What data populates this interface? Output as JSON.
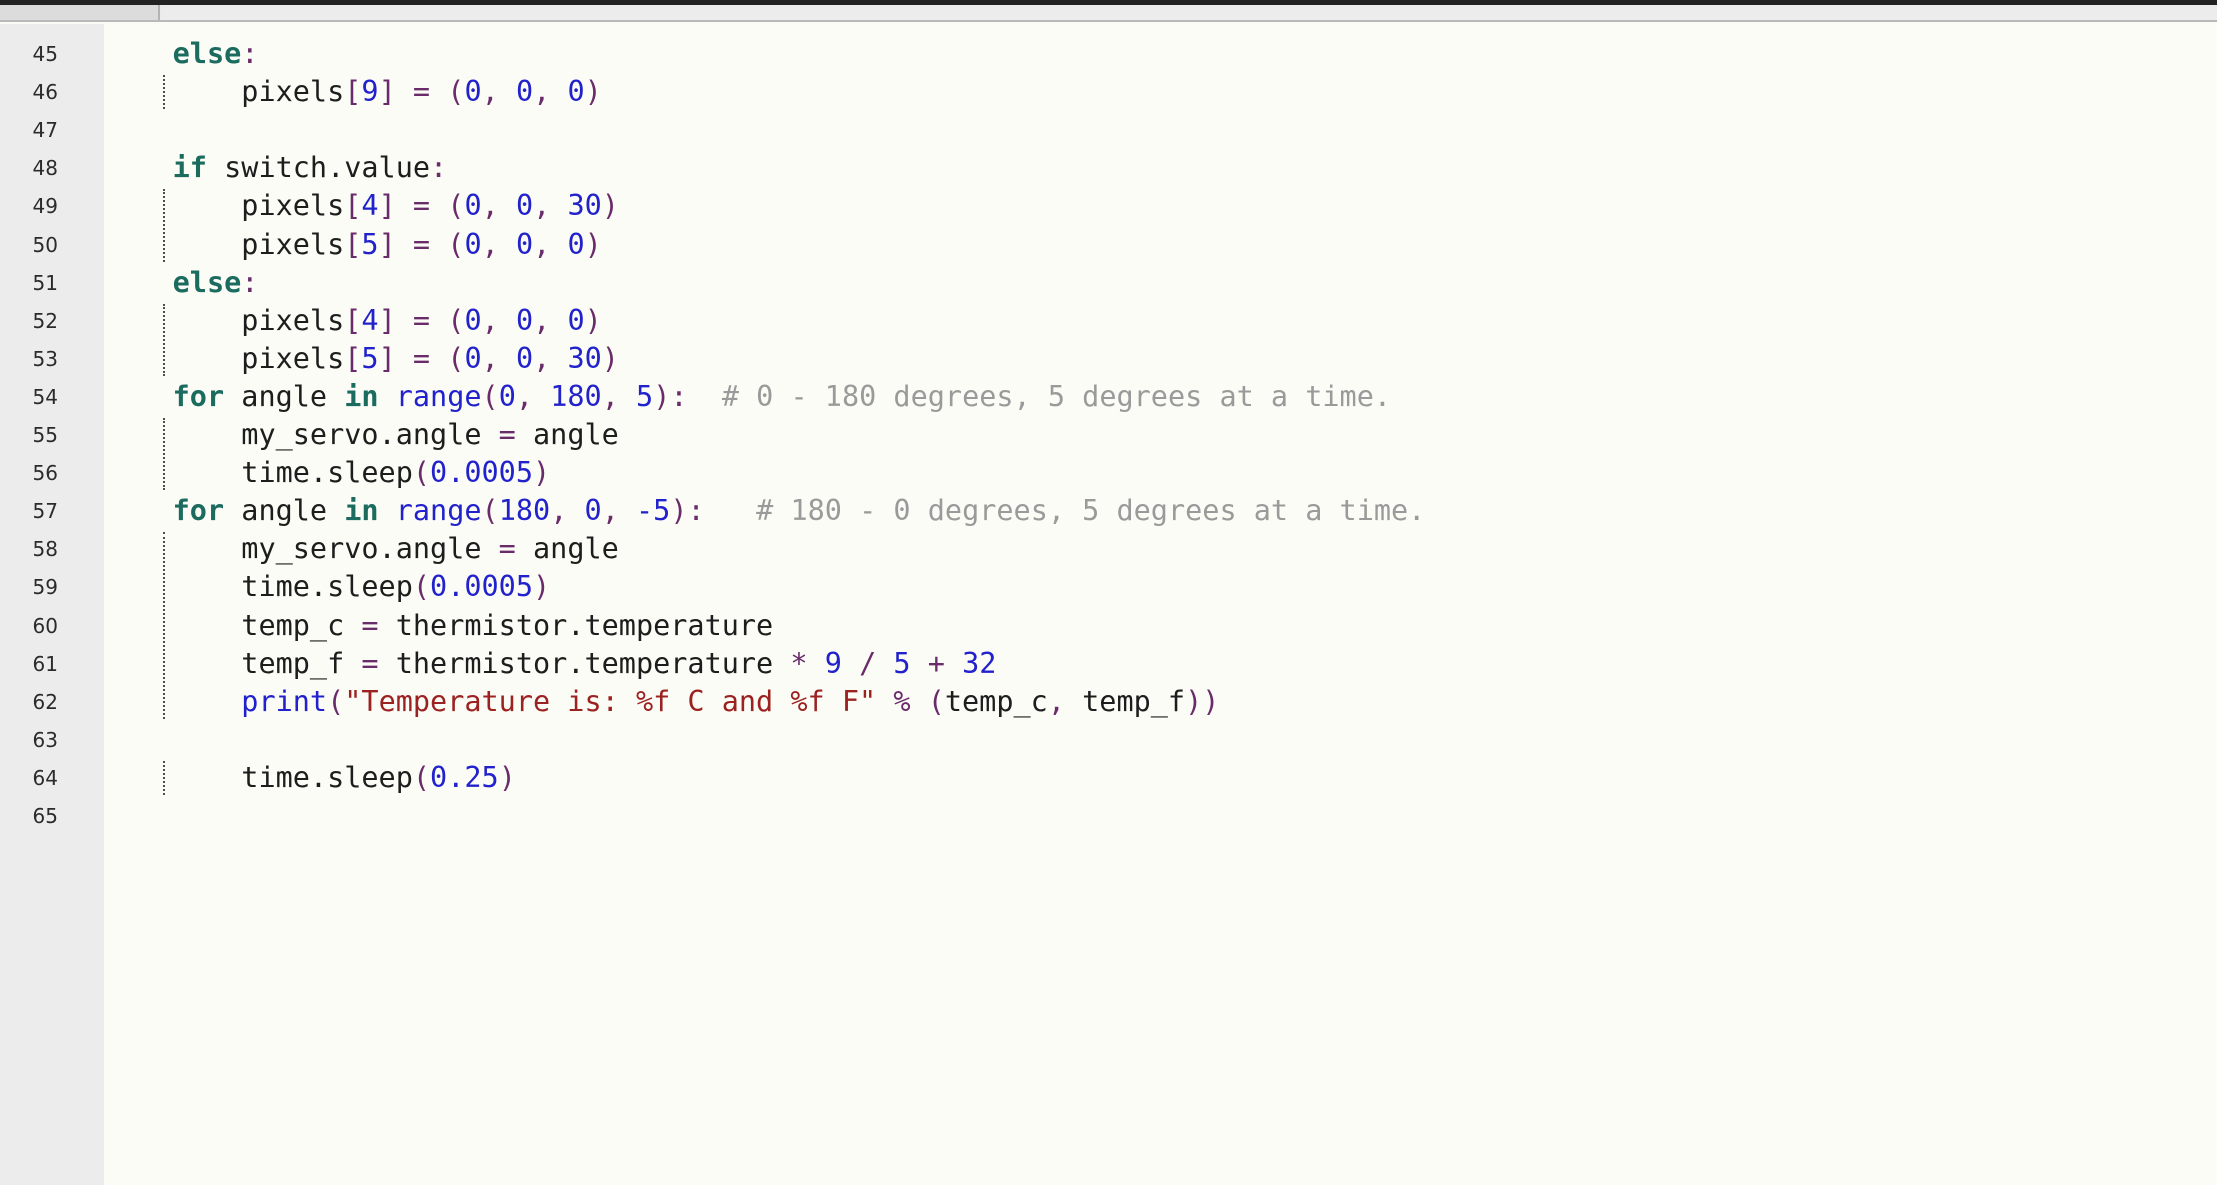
{
  "window": {
    "kind": "code-editor",
    "title_strip_color": "#232323",
    "toolbar_color": "#ebebeb",
    "tab_color": "#dcdcdc"
  },
  "editor": {
    "gutter_color": "#ececec",
    "background_color": "#fcfcf6",
    "language": "python",
    "first_visible_line": 45,
    "last_visible_line": 65,
    "indent_guide_color": "#2f2f2f",
    "theme_colors": {
      "keyword": "#1b6b5e",
      "function": "#2222cc",
      "number": "#2222cc",
      "operator": "#6a2b6a",
      "string": "#9c2222",
      "comment": "#9a9a9a",
      "identifier": "#1d1d1d"
    },
    "line_numbers": [
      "45",
      "46",
      "47",
      "48",
      "49",
      "50",
      "51",
      "52",
      "53",
      "54",
      "55",
      "56",
      "57",
      "58",
      "59",
      "60",
      "61",
      "62",
      "63",
      "64",
      "65"
    ],
    "lines": [
      {
        "number": "45",
        "text": "    else:"
      },
      {
        "number": "46",
        "text": "        pixels[9] = (0, 0, 0)"
      },
      {
        "number": "47",
        "text": ""
      },
      {
        "number": "48",
        "text": "    if switch.value:"
      },
      {
        "number": "49",
        "text": "        pixels[4] = (0, 0, 30)"
      },
      {
        "number": "50",
        "text": "        pixels[5] = (0, 0, 0)"
      },
      {
        "number": "51",
        "text": "    else:"
      },
      {
        "number": "52",
        "text": "        pixels[4] = (0, 0, 0)"
      },
      {
        "number": "53",
        "text": "        pixels[5] = (0, 0, 30)"
      },
      {
        "number": "54",
        "text": "    for angle in range(0, 180, 5):  # 0 - 180 degrees, 5 degrees at a time."
      },
      {
        "number": "55",
        "text": "        my_servo.angle = angle"
      },
      {
        "number": "56",
        "text": "        time.sleep(0.0005)"
      },
      {
        "number": "57",
        "text": "    for angle in range(180, 0, -5):   # 180 - 0 degrees, 5 degrees at a time."
      },
      {
        "number": "58",
        "text": "        my_servo.angle = angle"
      },
      {
        "number": "59",
        "text": "        time.sleep(0.0005)"
      },
      {
        "number": "60",
        "text": "        temp_c = thermistor.temperature"
      },
      {
        "number": "61",
        "text": "        temp_f = thermistor.temperature * 9 / 5 + 32"
      },
      {
        "number": "62",
        "text": "        print(\"Temperature is: %f C and %f F\" % (temp_c, temp_f))"
      },
      {
        "number": "63",
        "text": ""
      },
      {
        "number": "64",
        "text": "        time.sleep(0.25)"
      },
      {
        "number": "65",
        "text": ""
      }
    ],
    "tokens": {
      "l45": [
        {
          "t": "else",
          "c": "kw"
        },
        {
          "t": ":",
          "c": "op"
        }
      ],
      "l46": [
        {
          "t": "pixels",
          "c": "id"
        },
        {
          "t": "[",
          "c": "op"
        },
        {
          "t": "9",
          "c": "num"
        },
        {
          "t": "]",
          "c": "op"
        },
        {
          "t": " ",
          "c": "id"
        },
        {
          "t": "=",
          "c": "op"
        },
        {
          "t": " ",
          "c": "id"
        },
        {
          "t": "(",
          "c": "op"
        },
        {
          "t": "0",
          "c": "num"
        },
        {
          "t": ", ",
          "c": "op"
        },
        {
          "t": "0",
          "c": "num"
        },
        {
          "t": ", ",
          "c": "op"
        },
        {
          "t": "0",
          "c": "num"
        },
        {
          "t": ")",
          "c": "op"
        }
      ],
      "l48": [
        {
          "t": "if",
          "c": "kw"
        },
        {
          "t": " switch.value",
          "c": "id"
        },
        {
          "t": ":",
          "c": "op"
        }
      ],
      "l49": [
        {
          "t": "pixels",
          "c": "id"
        },
        {
          "t": "[",
          "c": "op"
        },
        {
          "t": "4",
          "c": "num"
        },
        {
          "t": "]",
          "c": "op"
        },
        {
          "t": " ",
          "c": "id"
        },
        {
          "t": "=",
          "c": "op"
        },
        {
          "t": " ",
          "c": "id"
        },
        {
          "t": "(",
          "c": "op"
        },
        {
          "t": "0",
          "c": "num"
        },
        {
          "t": ", ",
          "c": "op"
        },
        {
          "t": "0",
          "c": "num"
        },
        {
          "t": ", ",
          "c": "op"
        },
        {
          "t": "30",
          "c": "num"
        },
        {
          "t": ")",
          "c": "op"
        }
      ],
      "l50": [
        {
          "t": "pixels",
          "c": "id"
        },
        {
          "t": "[",
          "c": "op"
        },
        {
          "t": "5",
          "c": "num"
        },
        {
          "t": "]",
          "c": "op"
        },
        {
          "t": " ",
          "c": "id"
        },
        {
          "t": "=",
          "c": "op"
        },
        {
          "t": " ",
          "c": "id"
        },
        {
          "t": "(",
          "c": "op"
        },
        {
          "t": "0",
          "c": "num"
        },
        {
          "t": ", ",
          "c": "op"
        },
        {
          "t": "0",
          "c": "num"
        },
        {
          "t": ", ",
          "c": "op"
        },
        {
          "t": "0",
          "c": "num"
        },
        {
          "t": ")",
          "c": "op"
        }
      ],
      "l51": [
        {
          "t": "else",
          "c": "kw"
        },
        {
          "t": ":",
          "c": "op"
        }
      ],
      "l52": [
        {
          "t": "pixels",
          "c": "id"
        },
        {
          "t": "[",
          "c": "op"
        },
        {
          "t": "4",
          "c": "num"
        },
        {
          "t": "]",
          "c": "op"
        },
        {
          "t": " ",
          "c": "id"
        },
        {
          "t": "=",
          "c": "op"
        },
        {
          "t": " ",
          "c": "id"
        },
        {
          "t": "(",
          "c": "op"
        },
        {
          "t": "0",
          "c": "num"
        },
        {
          "t": ", ",
          "c": "op"
        },
        {
          "t": "0",
          "c": "num"
        },
        {
          "t": ", ",
          "c": "op"
        },
        {
          "t": "0",
          "c": "num"
        },
        {
          "t": ")",
          "c": "op"
        }
      ],
      "l53": [
        {
          "t": "pixels",
          "c": "id"
        },
        {
          "t": "[",
          "c": "op"
        },
        {
          "t": "5",
          "c": "num"
        },
        {
          "t": "]",
          "c": "op"
        },
        {
          "t": " ",
          "c": "id"
        },
        {
          "t": "=",
          "c": "op"
        },
        {
          "t": " ",
          "c": "id"
        },
        {
          "t": "(",
          "c": "op"
        },
        {
          "t": "0",
          "c": "num"
        },
        {
          "t": ", ",
          "c": "op"
        },
        {
          "t": "0",
          "c": "num"
        },
        {
          "t": ", ",
          "c": "op"
        },
        {
          "t": "30",
          "c": "num"
        },
        {
          "t": ")",
          "c": "op"
        }
      ],
      "l54": [
        {
          "t": "for",
          "c": "kw"
        },
        {
          "t": " angle ",
          "c": "id"
        },
        {
          "t": "in",
          "c": "kw"
        },
        {
          "t": " ",
          "c": "id"
        },
        {
          "t": "range",
          "c": "fn"
        },
        {
          "t": "(",
          "c": "op"
        },
        {
          "t": "0",
          "c": "num"
        },
        {
          "t": ", ",
          "c": "op"
        },
        {
          "t": "180",
          "c": "num"
        },
        {
          "t": ", ",
          "c": "op"
        },
        {
          "t": "5",
          "c": "num"
        },
        {
          "t": ")",
          "c": "op"
        },
        {
          "t": ":",
          "c": "op"
        },
        {
          "t": "  # 0 - 180 degrees, 5 degrees at a time.",
          "c": "cmt"
        }
      ],
      "l55": [
        {
          "t": "my_servo.angle ",
          "c": "id"
        },
        {
          "t": "=",
          "c": "op"
        },
        {
          "t": " angle",
          "c": "id"
        }
      ],
      "l56": [
        {
          "t": "time.sleep",
          "c": "id"
        },
        {
          "t": "(",
          "c": "op"
        },
        {
          "t": "0.0005",
          "c": "num"
        },
        {
          "t": ")",
          "c": "op"
        }
      ],
      "l57": [
        {
          "t": "for",
          "c": "kw"
        },
        {
          "t": " angle ",
          "c": "id"
        },
        {
          "t": "in",
          "c": "kw"
        },
        {
          "t": " ",
          "c": "id"
        },
        {
          "t": "range",
          "c": "fn"
        },
        {
          "t": "(",
          "c": "op"
        },
        {
          "t": "180",
          "c": "num"
        },
        {
          "t": ", ",
          "c": "op"
        },
        {
          "t": "0",
          "c": "num"
        },
        {
          "t": ", ",
          "c": "op"
        },
        {
          "t": "-5",
          "c": "num"
        },
        {
          "t": ")",
          "c": "op"
        },
        {
          "t": ":",
          "c": "op"
        },
        {
          "t": "   # 180 - 0 degrees, 5 degrees at a time.",
          "c": "cmt"
        }
      ],
      "l58": [
        {
          "t": "my_servo.angle ",
          "c": "id"
        },
        {
          "t": "=",
          "c": "op"
        },
        {
          "t": " angle",
          "c": "id"
        }
      ],
      "l59": [
        {
          "t": "time.sleep",
          "c": "id"
        },
        {
          "t": "(",
          "c": "op"
        },
        {
          "t": "0.0005",
          "c": "num"
        },
        {
          "t": ")",
          "c": "op"
        }
      ],
      "l60": [
        {
          "t": "temp_c ",
          "c": "id"
        },
        {
          "t": "=",
          "c": "op"
        },
        {
          "t": " thermistor.temperature",
          "c": "id"
        }
      ],
      "l61": [
        {
          "t": "temp_f ",
          "c": "id"
        },
        {
          "t": "=",
          "c": "op"
        },
        {
          "t": " thermistor.temperature ",
          "c": "id"
        },
        {
          "t": "*",
          "c": "op"
        },
        {
          "t": " ",
          "c": "id"
        },
        {
          "t": "9",
          "c": "num"
        },
        {
          "t": " ",
          "c": "id"
        },
        {
          "t": "/",
          "c": "op"
        },
        {
          "t": " ",
          "c": "id"
        },
        {
          "t": "5",
          "c": "num"
        },
        {
          "t": " ",
          "c": "id"
        },
        {
          "t": "+",
          "c": "op"
        },
        {
          "t": " ",
          "c": "id"
        },
        {
          "t": "32",
          "c": "num"
        }
      ],
      "l62": [
        {
          "t": "print",
          "c": "fn"
        },
        {
          "t": "(",
          "c": "op"
        },
        {
          "t": "\"Temperature is: %f C and %f F\"",
          "c": "str"
        },
        {
          "t": " ",
          "c": "id"
        },
        {
          "t": "%",
          "c": "op"
        },
        {
          "t": " ",
          "c": "id"
        },
        {
          "t": "(",
          "c": "op"
        },
        {
          "t": "temp_c",
          "c": "id"
        },
        {
          "t": ", ",
          "c": "op"
        },
        {
          "t": "temp_f",
          "c": "id"
        },
        {
          "t": ")",
          "c": "op"
        },
        {
          "t": ")",
          "c": "op"
        }
      ],
      "l64": [
        {
          "t": "time.sleep",
          "c": "id"
        },
        {
          "t": "(",
          "c": "op"
        },
        {
          "t": "0.25",
          "c": "num"
        },
        {
          "t": ")",
          "c": "op"
        }
      ]
    }
  }
}
